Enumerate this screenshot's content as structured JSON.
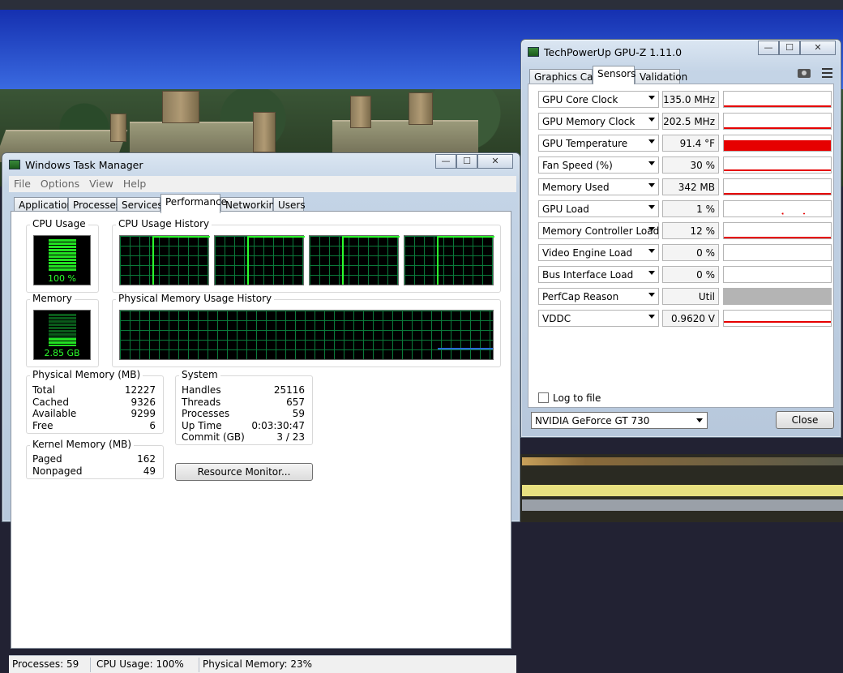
{
  "colors": {
    "graph_green": "#00d034",
    "sensor_red": "#e60000",
    "perfcap_gray": "#b4b4b4",
    "mem_line": "#2a6ad8"
  },
  "task_manager": {
    "title": "Windows Task Manager",
    "menu": [
      "File",
      "Options",
      "View",
      "Help"
    ],
    "tabs": [
      "Applications",
      "Processes",
      "Services",
      "Performance",
      "Networking",
      "Users"
    ],
    "active_tab": "Performance",
    "cpu_usage": {
      "label": "CPU Usage",
      "value": "100 %",
      "level": 1.0
    },
    "cpu_history": {
      "label": "CPU Usage History",
      "cores": 4
    },
    "memory": {
      "label": "Memory",
      "value": "2.85 GB",
      "level": 0.23
    },
    "mem_history": {
      "label": "Physical Memory Usage History",
      "level": 0.23
    },
    "physical_memory": {
      "label": "Physical Memory (MB)",
      "rows": [
        {
          "k": "Total",
          "v": "12227"
        },
        {
          "k": "Cached",
          "v": "9326"
        },
        {
          "k": "Available",
          "v": "9299"
        },
        {
          "k": "Free",
          "v": "6"
        }
      ]
    },
    "kernel_memory": {
      "label": "Kernel Memory (MB)",
      "rows": [
        {
          "k": "Paged",
          "v": "162"
        },
        {
          "k": "Nonpaged",
          "v": "49"
        }
      ]
    },
    "system": {
      "label": "System",
      "rows": [
        {
          "k": "Handles",
          "v": "25116"
        },
        {
          "k": "Threads",
          "v": "657"
        },
        {
          "k": "Processes",
          "v": "59"
        },
        {
          "k": "Up Time",
          "v": "0:03:30:47"
        },
        {
          "k": "Commit (GB)",
          "v": "3 / 23"
        }
      ]
    },
    "resource_monitor_button": "Resource Monitor...",
    "status": {
      "processes": "Processes: 59",
      "cpu": "CPU Usage: 100%",
      "memory": "Physical Memory: 23%"
    }
  },
  "gpuz": {
    "title": "TechPowerUp GPU-Z 1.11.0",
    "tabs": [
      "Graphics Card",
      "Sensors",
      "Validation"
    ],
    "active_tab": "Sensors",
    "sensors": [
      {
        "name": "GPU Core Clock",
        "value": "135.0 MHz",
        "graph": "line",
        "level": 0.05
      },
      {
        "name": "GPU Memory Clock",
        "value": "202.5 MHz",
        "graph": "line",
        "level": 0.05
      },
      {
        "name": "GPU Temperature",
        "value": "91.4 °F",
        "graph": "fill",
        "level": 0.7
      },
      {
        "name": "Fan Speed (%)",
        "value": "30 %",
        "graph": "line",
        "level": 0.2
      },
      {
        "name": "Memory Used",
        "value": "342 MB",
        "graph": "line",
        "level": 0.1
      },
      {
        "name": "GPU Load",
        "value": "1 %",
        "graph": "dots",
        "level": 0.01
      },
      {
        "name": "Memory Controller Load",
        "value": "12 %",
        "graph": "line",
        "level": 0.1
      },
      {
        "name": "Video Engine Load",
        "value": "0 %",
        "graph": "none",
        "level": 0
      },
      {
        "name": "Bus Interface Load",
        "value": "0 %",
        "graph": "none",
        "level": 0
      },
      {
        "name": "PerfCap Reason",
        "value": "Util",
        "graph": "gray",
        "level": 1
      },
      {
        "name": "VDDC",
        "value": "0.9620 V",
        "graph": "line",
        "level": 0.3
      }
    ],
    "log_to_file": "Log to file",
    "gpu_select": "NVIDIA GeForce GT 730",
    "close_button": "Close"
  }
}
